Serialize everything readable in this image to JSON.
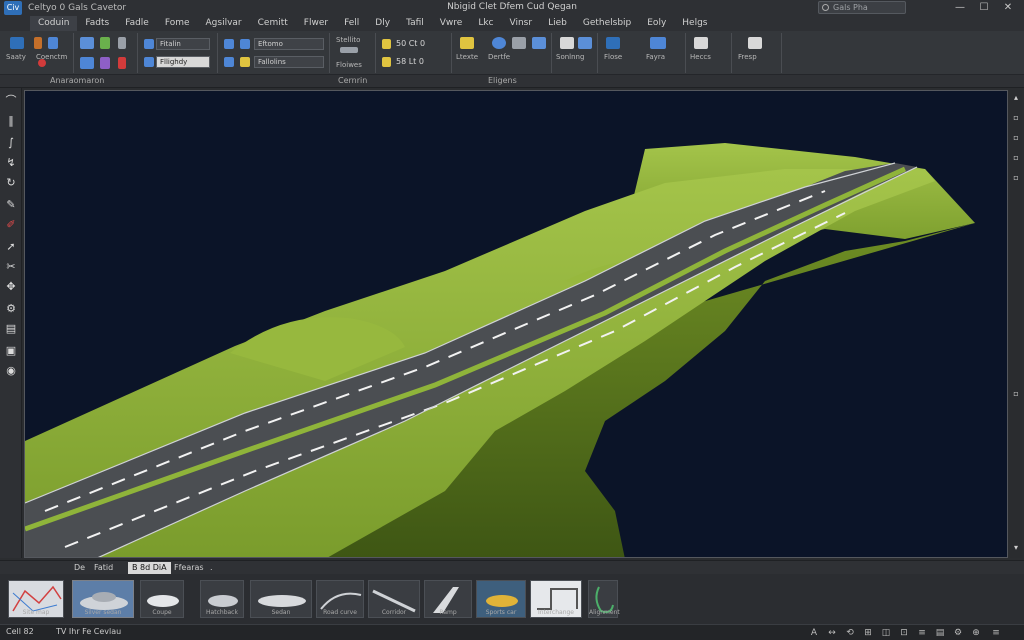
{
  "titlebar": {
    "logo_text": "Civ",
    "quick_access_title": "Celtyo 0 Gals Cavetor",
    "window_title": "Nbigid Clet Dfem Cud Qegan",
    "search_placeholder": "Gals Pha",
    "window_buttons": [
      "—",
      "☐",
      "✕"
    ]
  },
  "menu": {
    "items": [
      "Coduin",
      "Fadts",
      "Fadle",
      "Fome",
      "Agsilvar",
      "Cemitt",
      "Flwer",
      "Fell",
      "Dly",
      "Tafil",
      "Vwre",
      "Lkc",
      "Vinsr",
      "Lieb",
      "Gethelsbip",
      "Eoly",
      "Helgs"
    ]
  },
  "ribbon": {
    "combo1": "Fitalin",
    "combo2": "Fllighdy",
    "combo3": "Eftomo",
    "combo4": "Fallolins",
    "combo5": "Stellito",
    "combo6": "Floiwes",
    "value1": "50 Ct 0",
    "value2": "58 Lt 0",
    "labels": [
      "Saaty",
      "Coenctm",
      "Ltexte",
      "Dertfe",
      "Sonlnng",
      "Flose",
      "Fayra",
      "Heccs",
      "Fiteeve",
      "Fresp"
    ]
  },
  "panels": {
    "left": "Anaraomaron",
    "mid": "Cernrin",
    "right": "Eligens"
  },
  "tabs": {
    "items": [
      "De",
      "Fatid",
      "B 8d DiA",
      "Ffearas",
      "."
    ],
    "active_index": 2
  },
  "gallery": {
    "items": [
      "Site map",
      "Silver sedan",
      "Coupe",
      "Hatchback",
      "Sedan",
      "Road curve",
      "Corridor",
      "Ramp",
      "Sports car",
      "Interchange",
      "Alignment"
    ]
  },
  "status": {
    "coord_label": "Cell 82",
    "status_text": "TV Ihr Fe Cevlau",
    "right_icons": [
      "A",
      "↔",
      "⟲",
      "⊞",
      "◫",
      "⊡",
      "≡",
      "▤",
      "⚙",
      "⊕",
      "≡"
    ]
  },
  "colors": {
    "viewport_bg": "#0b1428",
    "terrain": "#8fb43a",
    "terrain_dark": "#4f6b1a",
    "road": "#4b4e52",
    "lane_marking": "#f2f2f2",
    "accent": "#2f6fb8"
  }
}
